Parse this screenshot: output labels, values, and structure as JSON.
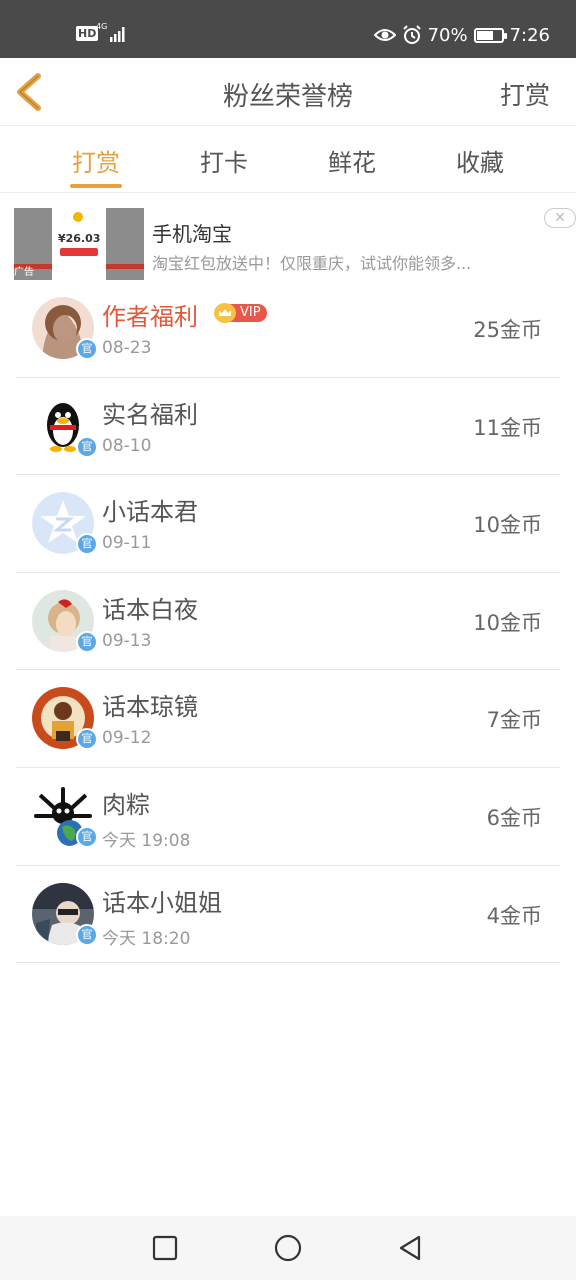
{
  "status_bar": {
    "hd": "HD",
    "network": "4G",
    "battery_percent": "70%",
    "battery_level": 0.7,
    "time": "7:26"
  },
  "header": {
    "title": "粉丝荣誉榜",
    "right_action": "打赏"
  },
  "tabs": [
    {
      "label": "打赏",
      "active": true
    },
    {
      "label": "打卡",
      "active": false
    },
    {
      "label": "鲜花",
      "active": false
    },
    {
      "label": "收藏",
      "active": false
    }
  ],
  "ad": {
    "title": "手机淘宝",
    "description": "淘宝红包放送中！仅限重庆，试试你能领多...",
    "image_amount": "¥26.03",
    "tag": "广告",
    "close": "✕"
  },
  "fans": [
    {
      "name": "作者福利",
      "date": "08-23",
      "amount": "25金币",
      "vip": "VIP",
      "is_author": true
    },
    {
      "name": "实名福利",
      "date": "08-10",
      "amount": "11金币"
    },
    {
      "name": "小话本君",
      "date": "09-11",
      "amount": "10金币"
    },
    {
      "name": "话本白夜",
      "date": "09-13",
      "amount": "10金币"
    },
    {
      "name": "话本琼镜",
      "date": "09-12",
      "amount": "7金币"
    },
    {
      "name": "肉粽",
      "date": "今天 19:08",
      "amount": "6金币"
    },
    {
      "name": "话本小姐姐",
      "date": "今天 18:20",
      "amount": "4金币"
    }
  ],
  "badge_glyph": "官",
  "colors": {
    "accent": "#e6a23c",
    "author_name": "#e05a3a",
    "status_bar": "#4a4a4a",
    "badge": "#5aa9e6"
  },
  "icons": {
    "back": "chevron-left-icon",
    "nav_recent": "square-icon",
    "nav_home": "circle-icon",
    "nav_back": "triangle-left-icon"
  }
}
